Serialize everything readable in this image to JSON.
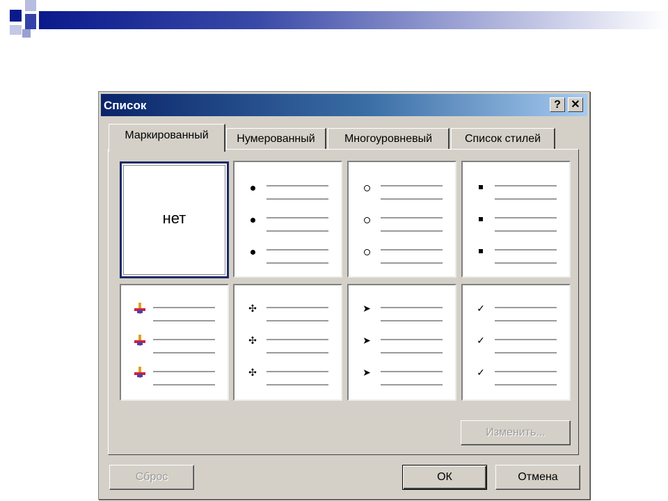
{
  "dialog": {
    "title": "Список",
    "help_label": "?",
    "close_label": "✕"
  },
  "tabs": [
    {
      "label": "Маркированный",
      "active": true
    },
    {
      "label": "Нумерованный",
      "active": false
    },
    {
      "label": "Многоуровневый",
      "active": false
    },
    {
      "label": "Список стилей",
      "active": false
    }
  ],
  "gallery": {
    "none_label": "нет",
    "cells": [
      {
        "name": "none",
        "selected": true
      },
      {
        "name": "bullet-dot",
        "icon": "filled-dot-icon"
      },
      {
        "name": "bullet-circle",
        "icon": "hollow-circle-icon"
      },
      {
        "name": "bullet-square",
        "icon": "filled-square-icon"
      },
      {
        "name": "bullet-picture",
        "icon": "colored-picture-bullet-icon"
      },
      {
        "name": "bullet-diamond",
        "icon": "four-diamond-icon",
        "glyph": "✣"
      },
      {
        "name": "bullet-arrow",
        "icon": "arrowhead-icon",
        "glyph": "➤"
      },
      {
        "name": "bullet-check",
        "icon": "checkmark-icon",
        "glyph": "✓"
      }
    ]
  },
  "buttons": {
    "modify": "Изменить...",
    "reset": "Сброс",
    "ok": "ОК",
    "cancel": "Отмена"
  },
  "colors": {
    "dialog_bg": "#d4d0c8",
    "titlebar_start": "#0a246a",
    "titlebar_end": "#a6caf0",
    "slide_bar": "#0a1a8c"
  }
}
